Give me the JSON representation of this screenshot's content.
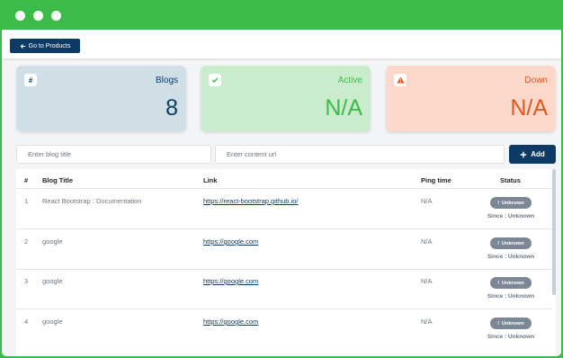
{
  "topbar": {
    "back_label": "Go to Products"
  },
  "cards": {
    "blogs": {
      "label": "Blogs",
      "value": "8",
      "icon": "hash-icon",
      "bg": "#d0dee6",
      "color": "#0d3b66"
    },
    "active": {
      "label": "Active",
      "value": "N/A",
      "icon": "check-icon",
      "bg": "#c9eccd",
      "color": "#3dbb4a"
    },
    "down": {
      "label": "Down",
      "value": "N/A",
      "icon": "warning-icon",
      "bg": "#fcd8cb",
      "color": "#e8541e"
    }
  },
  "form": {
    "title_placeholder": "Enter blog title",
    "url_placeholder": "Enter content url",
    "add_label": "Add"
  },
  "table": {
    "headers": {
      "num": "#",
      "title": "Blog Title",
      "link": "Link",
      "ping": "Ping time",
      "status": "Status"
    },
    "rows": [
      {
        "num": "1",
        "title": "React Bootstrap : Documentation",
        "link": "https://react-bootstrap.github.io/",
        "ping": "N/A",
        "status": "Unknown",
        "since": "Since : Unknown"
      },
      {
        "num": "2",
        "title": "google",
        "link": "https://google.com",
        "ping": "N/A",
        "status": "Unknown",
        "since": "Since : Unknown"
      },
      {
        "num": "3",
        "title": "google",
        "link": "https://google.com",
        "ping": "N/A",
        "status": "Unknown",
        "since": "Since : Unknown"
      },
      {
        "num": "4",
        "title": "google",
        "link": "https://google.com",
        "ping": "N/A",
        "status": "Unknown",
        "since": "Since : Unknown"
      }
    ]
  },
  "colors": {
    "window": "#3dbb4a",
    "primary": "#0d3b66"
  }
}
